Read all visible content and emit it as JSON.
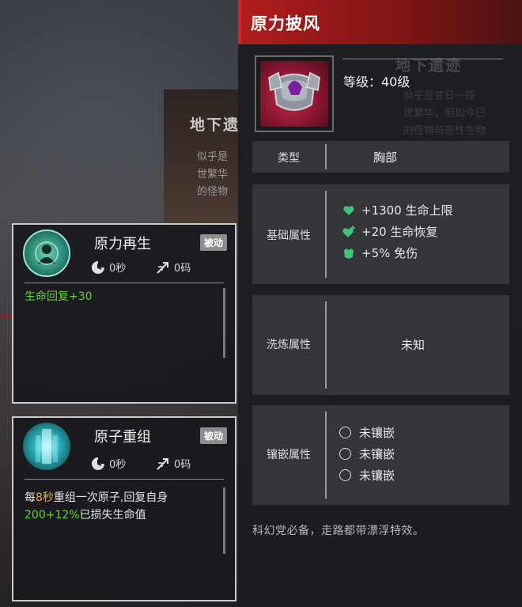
{
  "background": {
    "card_title": "地下遗",
    "card_lines": [
      "似乎是",
      "世繁华",
      "的怪物"
    ],
    "ghost_title": "地下遗迹",
    "ghost_lines": [
      "似乎是昔日一段",
      "世繁华，但如今已",
      "的怪物与恶性生物"
    ]
  },
  "skills": [
    {
      "name": "原力再生",
      "tag": "被动",
      "cooldown": "0秒",
      "range": "0码",
      "desc_green": "生命回复+30"
    },
    {
      "name": "原子重组",
      "tag": "被动",
      "cooldown": "0秒",
      "range": "0码",
      "desc_prefix": "每",
      "desc_gold": "8秒",
      "desc_mid": "重组一次原子,回复自身",
      "desc_green": "200+12%",
      "desc_suffix": "已损失生命值"
    }
  ],
  "item": {
    "title": "原力披风",
    "level": "等级：40级",
    "type_label": "类型",
    "type_value": "胸部",
    "base_label": "基础属性",
    "base_stats": [
      {
        "icon": "heart-icon",
        "text": "+1300 生命上限"
      },
      {
        "icon": "heart-plus-icon",
        "text": "+20 生命恢复"
      },
      {
        "icon": "armor-icon",
        "text": "+5% 免伤"
      }
    ],
    "refine_label": "洗炼属性",
    "refine_value": "未知",
    "socket_label": "镶嵌属性",
    "sockets": [
      "未镶嵌",
      "未镶嵌",
      "未镶嵌"
    ],
    "flavor": "科幻党必备，走路都带漂浮特效。"
  },
  "colors": {
    "header_red": "#b01d1d",
    "stat_green": "#3fc47a",
    "text_green": "#5fd52e",
    "text_gold": "#e4b43c"
  }
}
